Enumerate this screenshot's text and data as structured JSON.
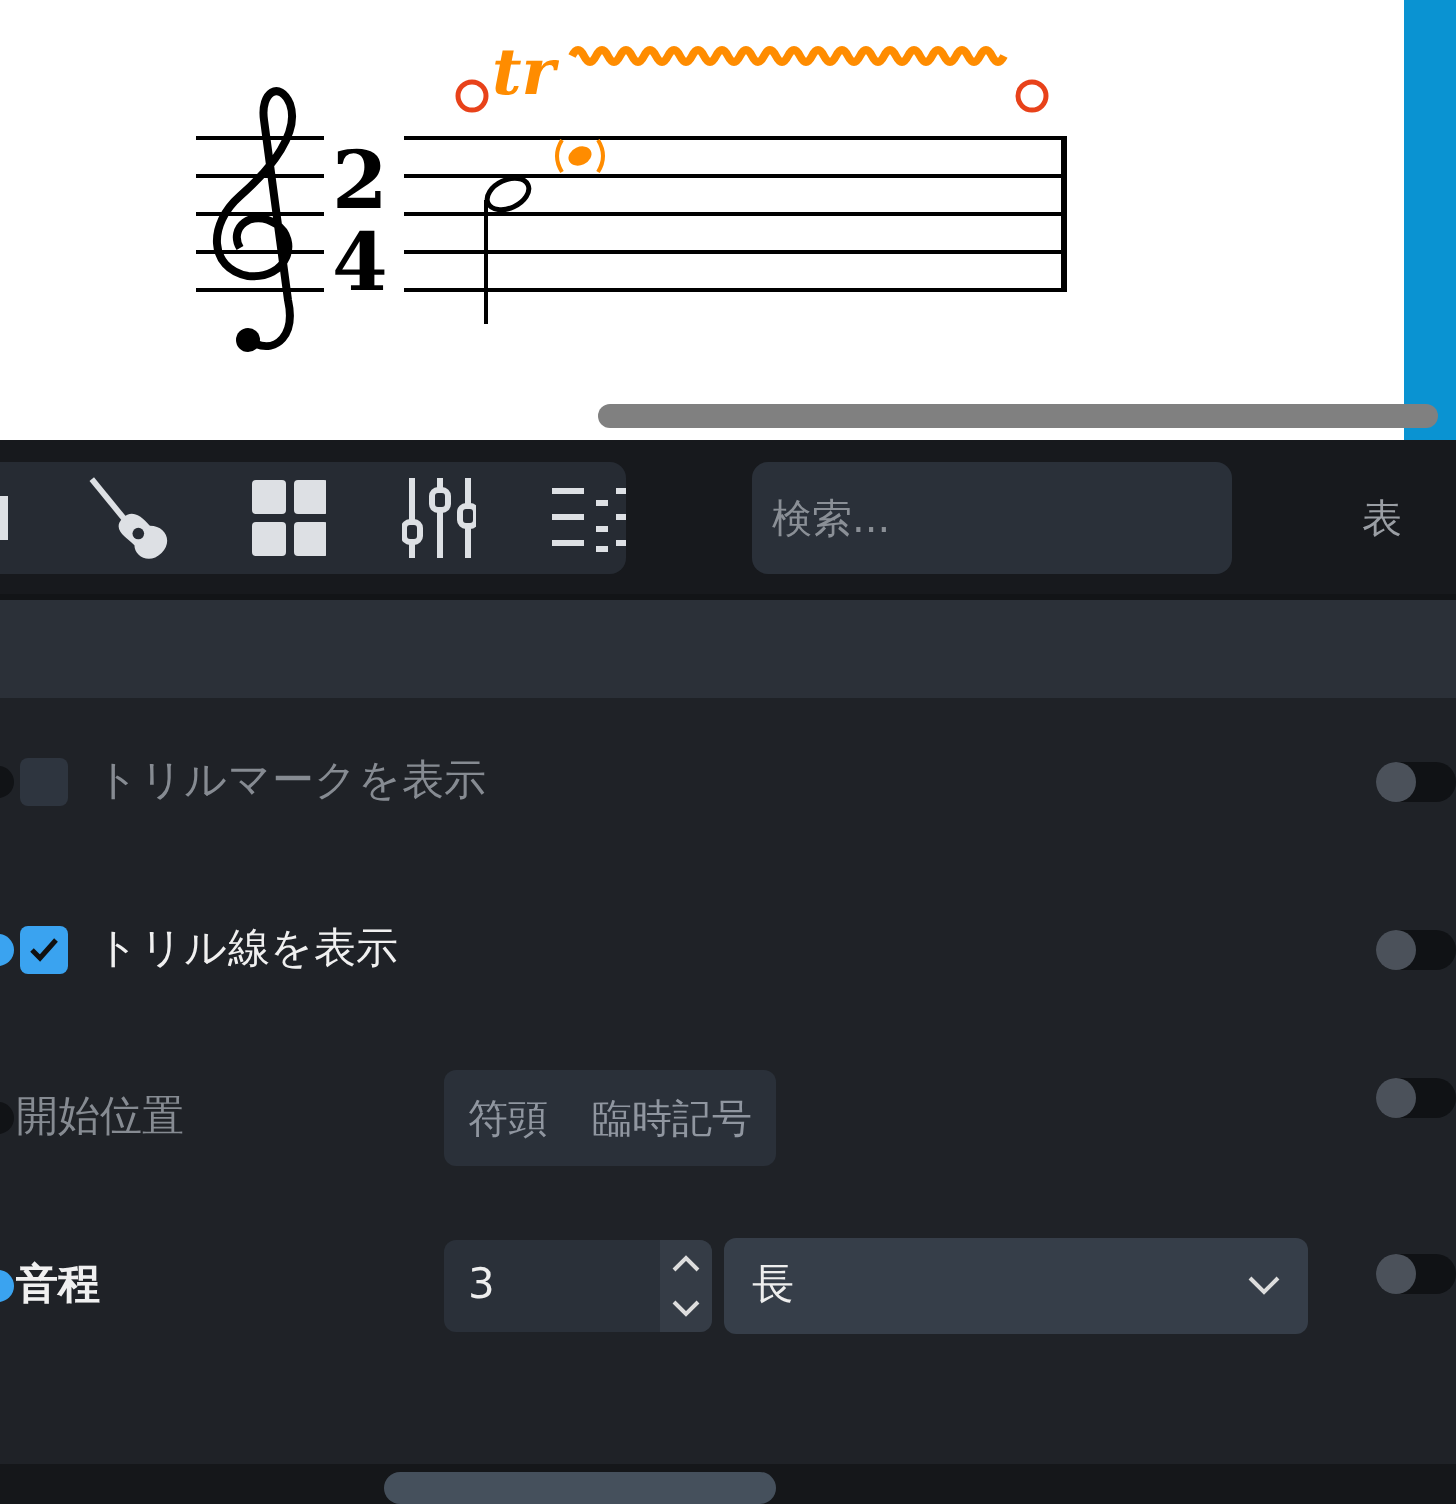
{
  "score": {
    "time_signature": {
      "numerator": "2",
      "denominator": "4"
    },
    "trill": {
      "mark": "tr"
    }
  },
  "toolbar": {
    "search": {
      "placeholder": "検索..."
    },
    "label": "表"
  },
  "properties": [
    {
      "kind": "checkbox",
      "label": "トリルマークを表示",
      "checked": false,
      "enabled": false,
      "on": false
    },
    {
      "kind": "checkbox",
      "label": "トリル線を表示",
      "checked": true,
      "enabled": true,
      "on": false
    },
    {
      "kind": "segmented",
      "label": "開始位置",
      "enabled": false,
      "on": false,
      "options": [
        {
          "label": "符頭",
          "selected": false
        },
        {
          "label": "臨時記号",
          "selected": false
        }
      ]
    },
    {
      "kind": "interval",
      "label": "音程",
      "enabled": true,
      "on": false,
      "number": "3",
      "quality": "長"
    }
  ]
}
